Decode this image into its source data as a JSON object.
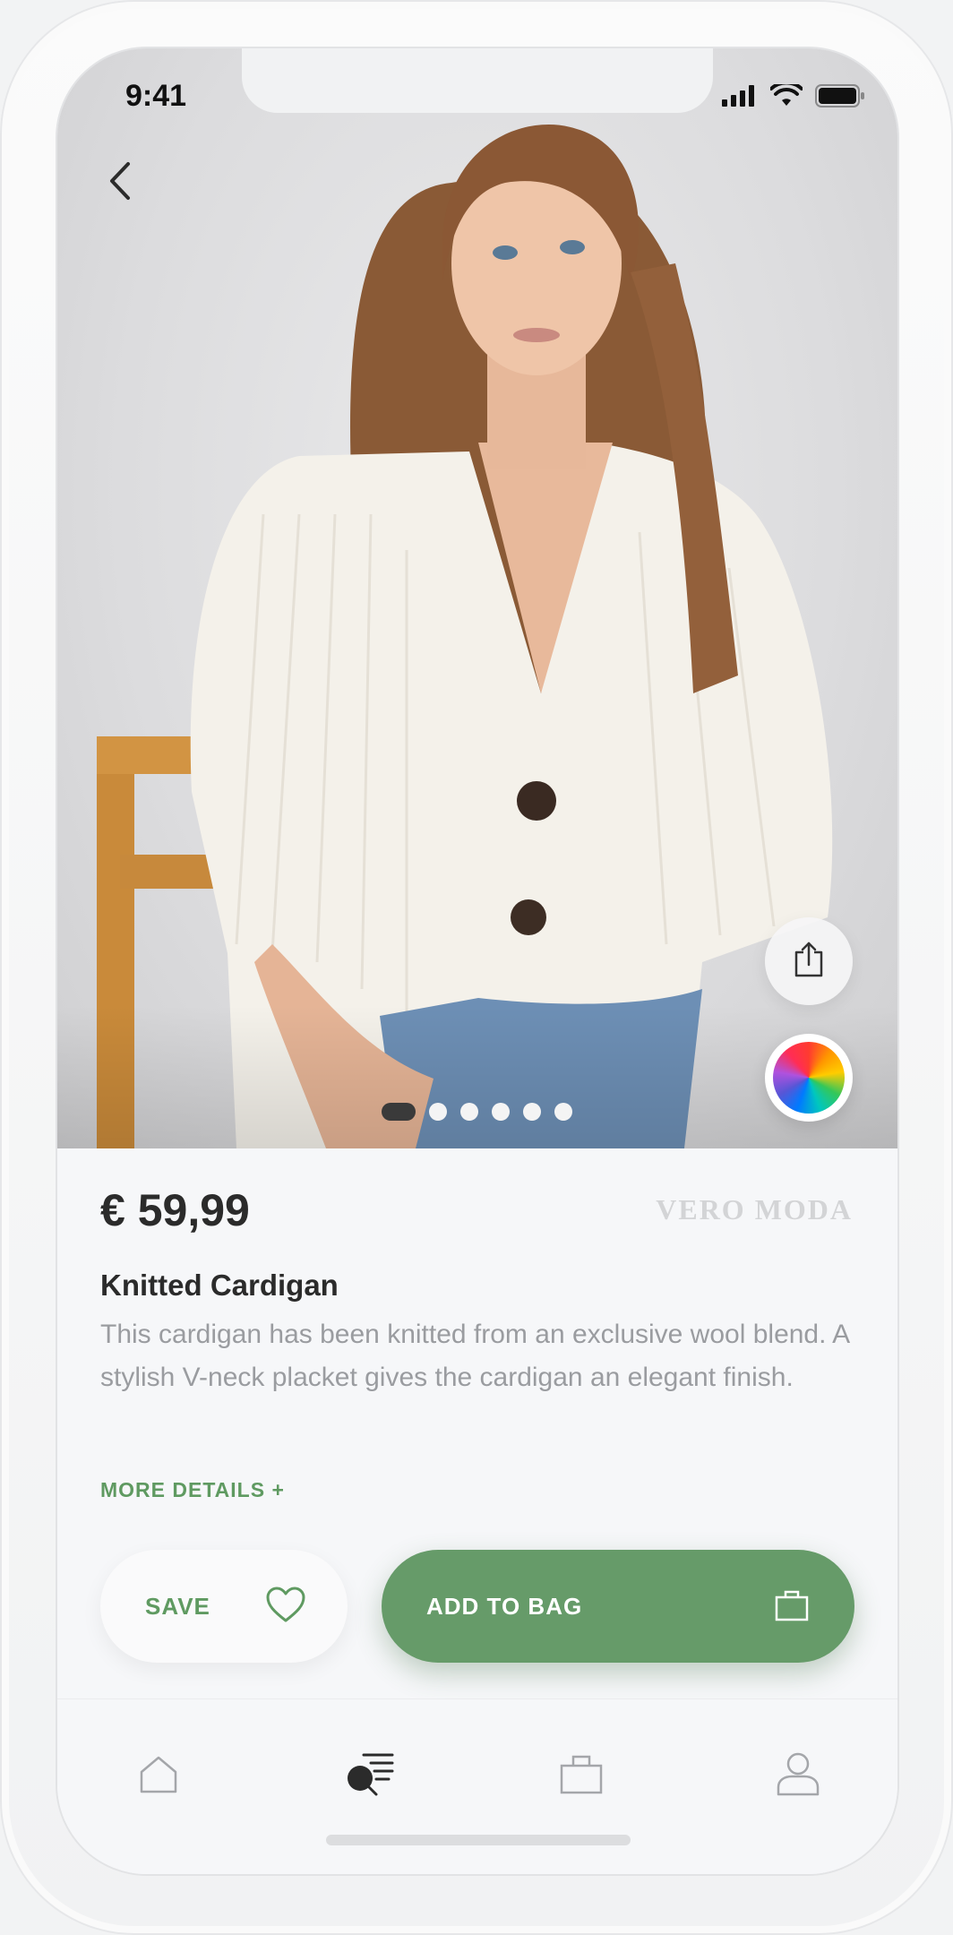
{
  "status_bar": {
    "time": "9:41",
    "icons": [
      "cellular-signal-icon",
      "wifi-icon",
      "battery-icon"
    ]
  },
  "hero": {
    "back_icon": "chevron-left-icon",
    "share_icon": "share-icon",
    "color_picker_icon": "color-wheel-icon",
    "image_pagination": {
      "total": 6,
      "current": 1
    }
  },
  "product": {
    "price": "€ 59,99",
    "brand": "VERO MODA",
    "title": "Knitted Cardigan",
    "description": "This cardigan has been knitted from an exclusive wool blend. A stylish V-neck placket gives the cardigan an elegant finish.",
    "more_details": "MORE DETAILS +"
  },
  "actions": {
    "save_label": "SAVE",
    "add_to_bag_label": "ADD TO BAG"
  },
  "bottom_nav": {
    "items": [
      {
        "name": "home",
        "icon": "home-icon",
        "active": false
      },
      {
        "name": "search",
        "icon": "search-list-icon",
        "active": true
      },
      {
        "name": "bag",
        "icon": "shopping-bag-icon",
        "active": false
      },
      {
        "name": "profile",
        "icon": "user-icon",
        "active": false
      }
    ]
  },
  "colors": {
    "accent": "#669b69",
    "accent_text": "#5f9a61",
    "text_primary": "#2b2b2b",
    "text_secondary": "#9a9ca0",
    "brand_text": "#d3d4d6",
    "nav_inactive": "#a4a6aa",
    "nav_active": "#2b2b2b"
  }
}
